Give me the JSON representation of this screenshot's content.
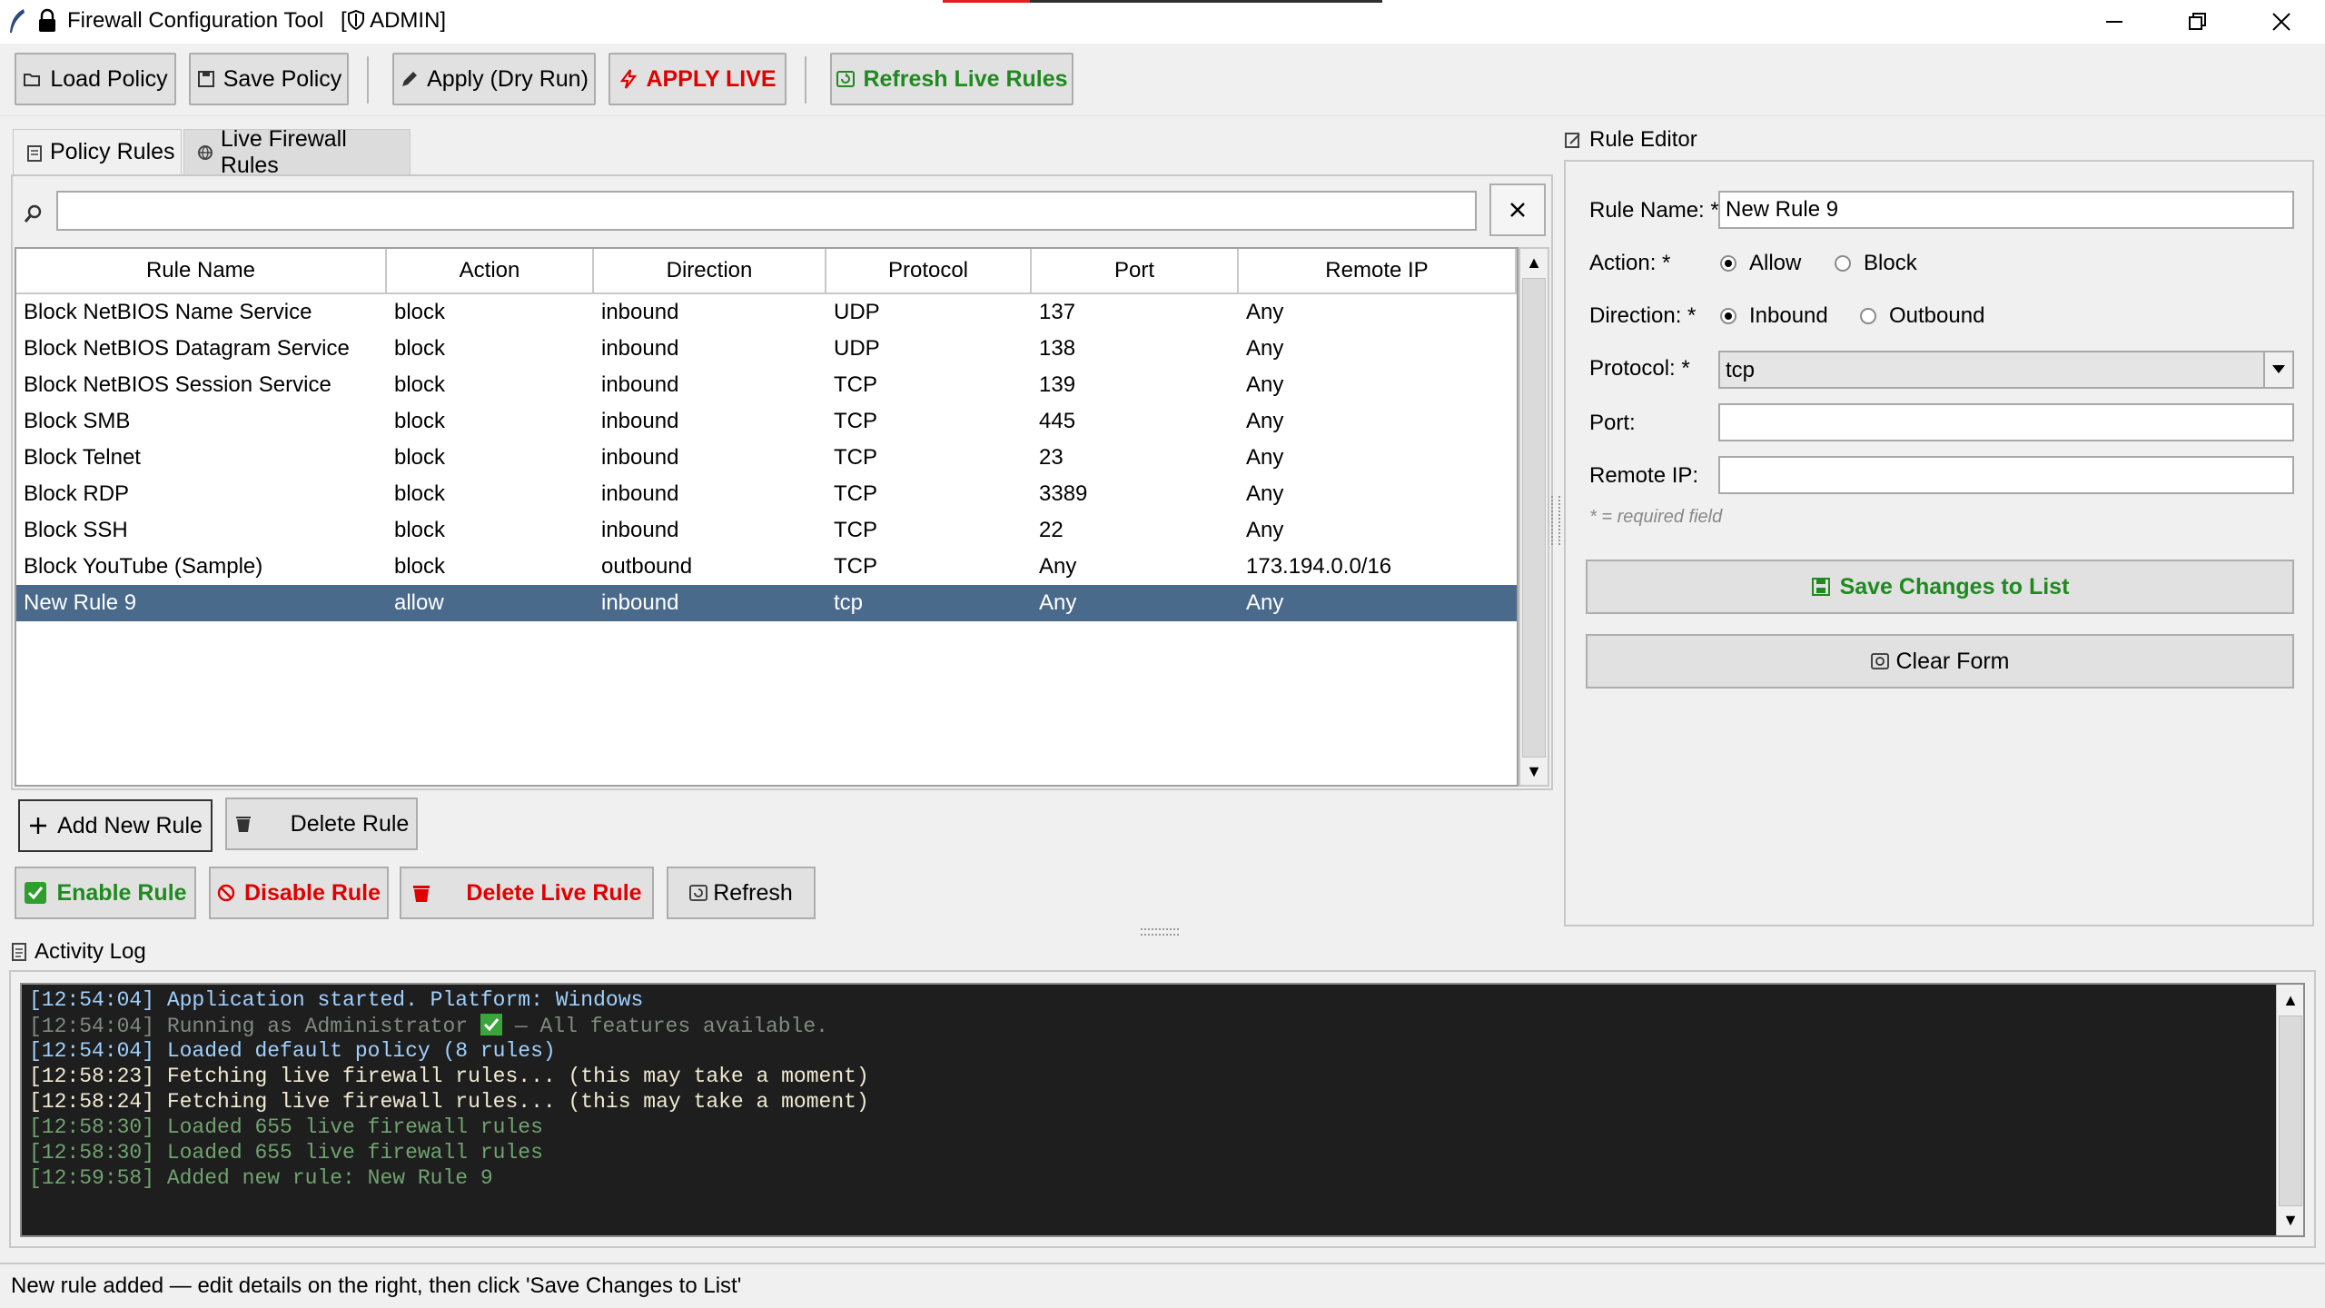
{
  "window": {
    "title": "Firewall Configuration Tool",
    "admin_badge": "ADMIN"
  },
  "toolbar": {
    "load_policy": "Load Policy",
    "save_policy": "Save Policy",
    "apply_dry_run": "Apply (Dry Run)",
    "apply_live": "APPLY LIVE",
    "refresh_live_rules": "Refresh Live Rules"
  },
  "tabs": {
    "policy_rules": "Policy Rules",
    "live_firewall_rules": "Live Firewall Rules"
  },
  "search": {
    "value": "",
    "placeholder": ""
  },
  "table": {
    "columns": [
      "Rule Name",
      "Action",
      "Direction",
      "Protocol",
      "Port",
      "Remote IP"
    ],
    "rows": [
      [
        "Block NetBIOS Name Service",
        "block",
        "inbound",
        "UDP",
        "137",
        "Any"
      ],
      [
        "Block NetBIOS Datagram Service",
        "block",
        "inbound",
        "UDP",
        "138",
        "Any"
      ],
      [
        "Block NetBIOS Session Service",
        "block",
        "inbound",
        "TCP",
        "139",
        "Any"
      ],
      [
        "Block SMB",
        "block",
        "inbound",
        "TCP",
        "445",
        "Any"
      ],
      [
        "Block Telnet",
        "block",
        "inbound",
        "TCP",
        "23",
        "Any"
      ],
      [
        "Block RDP",
        "block",
        "inbound",
        "TCP",
        "3389",
        "Any"
      ],
      [
        "Block SSH",
        "block",
        "inbound",
        "TCP",
        "22",
        "Any"
      ],
      [
        "Block YouTube (Sample)",
        "block",
        "outbound",
        "TCP",
        "Any",
        "173.194.0.0/16"
      ],
      [
        "New Rule 9",
        "allow",
        "inbound",
        "tcp",
        "Any",
        "Any"
      ]
    ],
    "selected_row": 8
  },
  "actions": {
    "add_new_rule": "Add New Rule",
    "delete_rule": "Delete Rule",
    "enable_rule": "Enable Rule",
    "disable_rule": "Disable Rule",
    "delete_live_rule": "Delete Live Rule",
    "refresh": "Refresh"
  },
  "editor": {
    "title": "Rule Editor",
    "rule_name_label": "Rule Name: *",
    "rule_name_value": "New Rule 9",
    "action_label": "Action: *",
    "action_options": [
      "Allow",
      "Block"
    ],
    "action_selected": "Allow",
    "direction_label": "Direction: *",
    "direction_options": [
      "Inbound",
      "Outbound"
    ],
    "direction_selected": "Inbound",
    "protocol_label": "Protocol: *",
    "protocol_value": "tcp",
    "port_label": "Port:",
    "port_value": "",
    "remote_ip_label": "Remote IP:",
    "remote_ip_value": "",
    "required_note": "* = required field",
    "save_changes": "Save Changes to List",
    "clear_form": "Clear Form"
  },
  "log": {
    "title": "Activity Log",
    "lines": [
      {
        "text": "[12:54:04] Application started. Platform: Windows",
        "color": "#9fd0ff"
      },
      {
        "text": "[12:54:04] Running as Administrator",
        "suffix": " — All features available.",
        "color": "#7f8a7f"
      },
      {
        "text": "[12:54:04] Loaded default policy (8 rules)",
        "color": "#9fd0ff"
      },
      {
        "text": "[12:58:23] Fetching live firewall rules... (this may take a moment)",
        "color": "#f0ead2"
      },
      {
        "text": "[12:58:24] Fetching live firewall rules... (this may take a moment)",
        "color": "#f0ead2"
      },
      {
        "text": "[12:58:30] Loaded 655 live firewall rules",
        "color": "#6fa36f"
      },
      {
        "text": "[12:58:30] Loaded 655 live firewall rules",
        "color": "#6fa36f"
      },
      {
        "text": "[12:59:58] Added new rule: New Rule 9",
        "color": "#6fa36f"
      }
    ]
  },
  "status": "New rule added — edit details on the right, then click 'Save Changes to List'",
  "colors": {
    "selection": "#4a6a8b",
    "danger": "#e00000",
    "success": "#1f8a1f"
  }
}
